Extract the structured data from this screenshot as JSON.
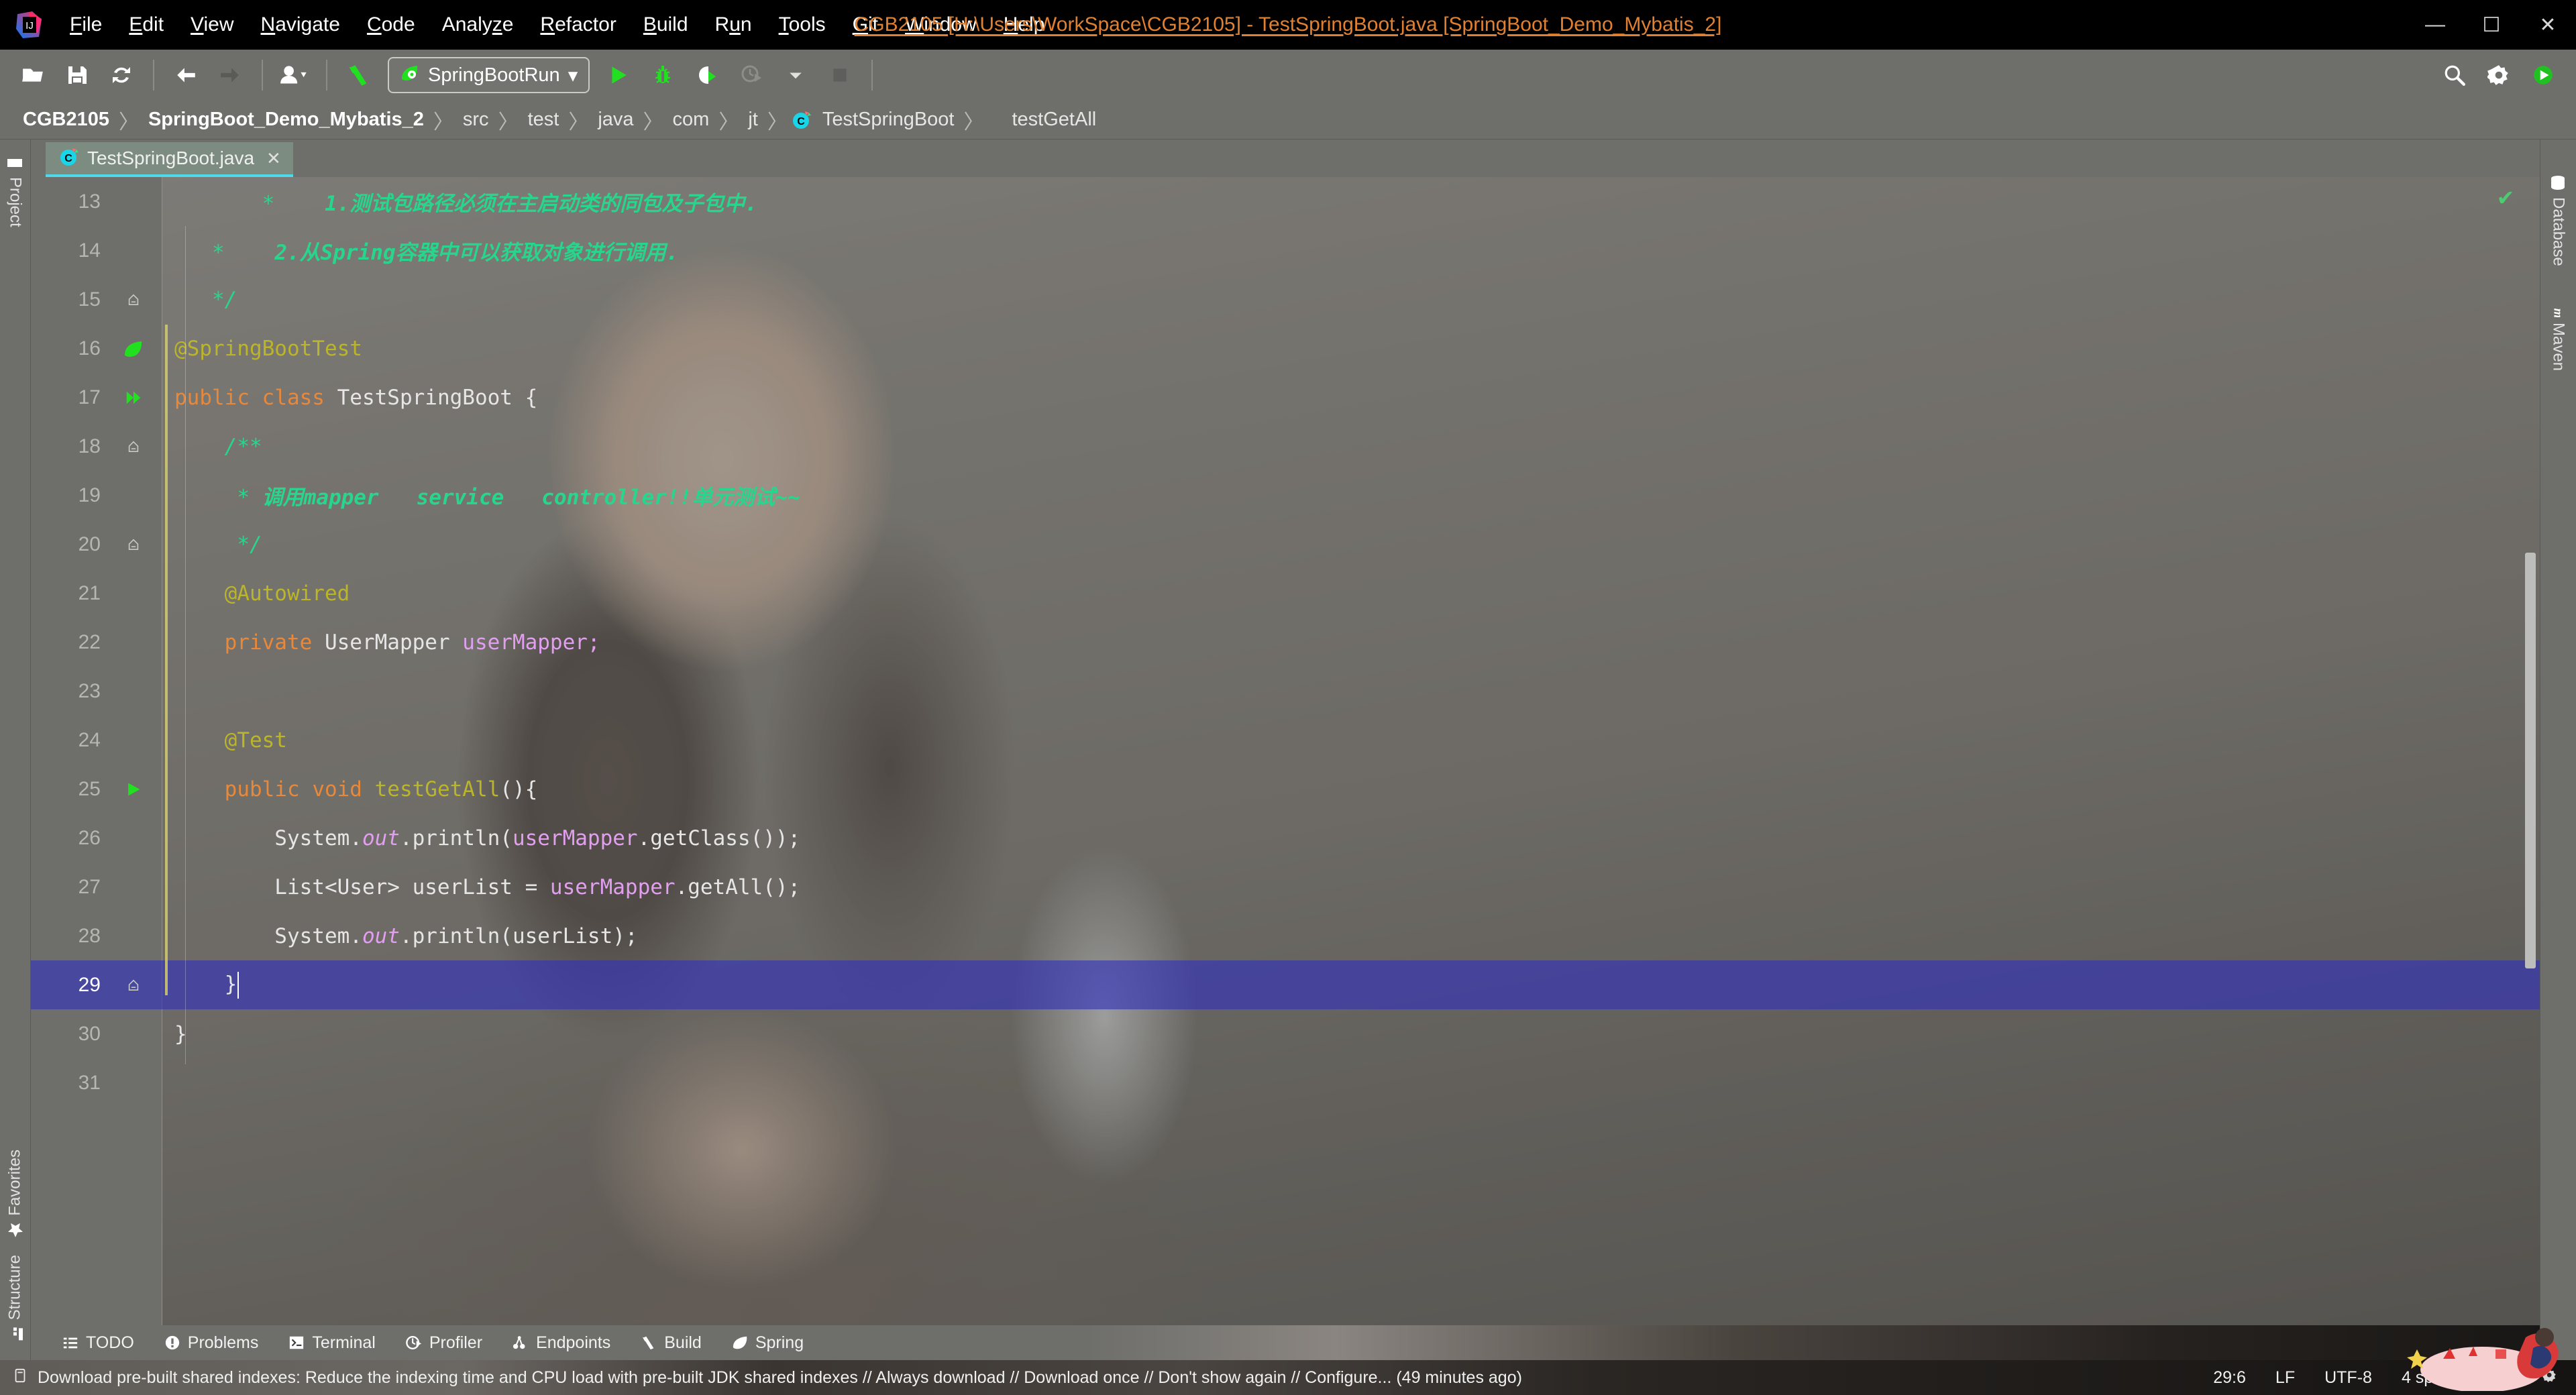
{
  "window": {
    "title": "CGB2105 [H:\\Users\\WorkSpace\\CGB2105] - TestSpringBoot.java [SpringBoot_Demo_Mybatis_2]",
    "minimize": "—",
    "maximize": "☐",
    "close": "✕",
    "accent_orange": "#e08030",
    "titlebar_bg": "#000000",
    "chrome_bg": "#6e6e6b"
  },
  "menu": {
    "items": [
      {
        "label": "File",
        "mnemonic": "F"
      },
      {
        "label": "Edit",
        "mnemonic": "E"
      },
      {
        "label": "View",
        "mnemonic": "V"
      },
      {
        "label": "Navigate",
        "mnemonic": "N"
      },
      {
        "label": "Code",
        "mnemonic": "C"
      },
      {
        "label": "Analyze",
        "mnemonic": "z"
      },
      {
        "label": "Refactor",
        "mnemonic": "R"
      },
      {
        "label": "Build",
        "mnemonic": "B"
      },
      {
        "label": "Run",
        "mnemonic": "u"
      },
      {
        "label": "Tools",
        "mnemonic": "T"
      },
      {
        "label": "Git",
        "mnemonic": "G"
      },
      {
        "label": "Window",
        "mnemonic": "W"
      },
      {
        "label": "Help",
        "mnemonic": "H"
      }
    ]
  },
  "toolbar": {
    "icons": [
      "open-folder-icon",
      "save-all-icon",
      "sync-refresh-icon",
      "back-arrow-icon",
      "forward-arrow-icon",
      "profile-dropdown-icon",
      "build-hammer-icon"
    ],
    "run_config": {
      "label": "SpringBootRun",
      "icon": "spring-leaf-icon",
      "chevron": "▾"
    },
    "run_actions": [
      "run-icon",
      "debug-icon",
      "run-with-coverage-icon",
      "profile-icon",
      "more-chevron-icon",
      "stop-icon"
    ],
    "right_icons": [
      "search-icon",
      "settings-gear-icon",
      "update-project-icon"
    ]
  },
  "breadcrumb": {
    "items": [
      {
        "label": "CGB2105",
        "bold": true,
        "icon": null
      },
      {
        "label": "SpringBoot_Demo_Mybatis_2",
        "bold": true,
        "icon": null
      },
      {
        "label": "src",
        "bold": false,
        "icon": null
      },
      {
        "label": "test",
        "bold": false,
        "icon": null
      },
      {
        "label": "java",
        "bold": false,
        "icon": null
      },
      {
        "label": "com",
        "bold": false,
        "icon": null
      },
      {
        "label": "jt",
        "bold": false,
        "icon": null
      },
      {
        "label": "TestSpringBoot",
        "bold": false,
        "icon": "java-class-icon"
      },
      {
        "label": "testGetAll",
        "bold": false,
        "icon": null
      }
    ],
    "separator": "〉"
  },
  "editor_tabs": [
    {
      "label": "TestSpringBoot.java",
      "icon": "java-class-icon",
      "close": "✕",
      "active": true
    }
  ],
  "left_toolwindows": [
    {
      "label": "Project",
      "icon": "project-folder-icon"
    },
    {
      "label": "Structure",
      "icon": "structure-icon"
    },
    {
      "label": "Favorites",
      "icon": "star-icon"
    }
  ],
  "right_toolwindows": [
    {
      "label": "Database",
      "icon": "database-icon"
    },
    {
      "label": "Maven",
      "icon": "maven-m-icon"
    }
  ],
  "code": {
    "first_visible_line": 13,
    "current_line": 29,
    "lines": [
      {
        "n": 13,
        "gutter": "",
        "tokens": [
          {
            "t": "       *    ",
            "c": "cmt"
          },
          {
            "t": "1.测试包路径必须在主启动类的同包及子包中.",
            "c": "cmt-b"
          }
        ]
      },
      {
        "n": 14,
        "gutter": "",
        "tokens": [
          {
            "t": "   *    ",
            "c": "cmt"
          },
          {
            "t": "2.从Spring容器中可以获取对象进行调用.",
            "c": "cmt-b"
          }
        ]
      },
      {
        "n": 15,
        "gutter": "fold-end",
        "tokens": [
          {
            "t": "   */",
            "c": "cmt"
          }
        ]
      },
      {
        "n": 16,
        "gutter": "spring-bean",
        "tokens": [
          {
            "t": "@SpringBootTest",
            "c": "ann"
          }
        ]
      },
      {
        "n": 17,
        "gutter": "run-class",
        "tokens": [
          {
            "t": "public ",
            "c": "kw"
          },
          {
            "t": "class ",
            "c": "kw"
          },
          {
            "t": "TestSpringBoot ",
            "c": "plain"
          },
          {
            "t": "{",
            "c": "plain"
          }
        ]
      },
      {
        "n": 18,
        "gutter": "fold-start",
        "tokens": [
          {
            "t": "    /**",
            "c": "cmt"
          }
        ]
      },
      {
        "n": 19,
        "gutter": "",
        "tokens": [
          {
            "t": "     * ",
            "c": "cmt"
          },
          {
            "t": "调用mapper   service   controller!!单元测试~~",
            "c": "cmt-b"
          }
        ]
      },
      {
        "n": 20,
        "gutter": "fold-end",
        "tokens": [
          {
            "t": "     */",
            "c": "cmt"
          }
        ]
      },
      {
        "n": 21,
        "gutter": "",
        "tokens": [
          {
            "t": "    @Autowired",
            "c": "ann"
          }
        ]
      },
      {
        "n": 22,
        "gutter": "",
        "tokens": [
          {
            "t": "    private ",
            "c": "kw"
          },
          {
            "t": "UserMapper ",
            "c": "plain"
          },
          {
            "t": "userMapper;",
            "c": "fld"
          }
        ]
      },
      {
        "n": 23,
        "gutter": "",
        "tokens": [
          {
            "t": "",
            "c": "plain"
          }
        ]
      },
      {
        "n": 24,
        "gutter": "",
        "tokens": [
          {
            "t": "    @Test",
            "c": "ann"
          }
        ]
      },
      {
        "n": 25,
        "gutter": "run-method",
        "tokens": [
          {
            "t": "    public ",
            "c": "kw"
          },
          {
            "t": "void ",
            "c": "kw"
          },
          {
            "t": "testGetAll",
            "c": "ann"
          },
          {
            "t": "(){",
            "c": "plain"
          }
        ]
      },
      {
        "n": 26,
        "gutter": "",
        "tokens": [
          {
            "t": "        System.",
            "c": "plain"
          },
          {
            "t": "out",
            "c": "stat"
          },
          {
            "t": ".println(",
            "c": "plain"
          },
          {
            "t": "userMapper",
            "c": "fld"
          },
          {
            "t": ".getClass());",
            "c": "plain"
          }
        ]
      },
      {
        "n": 27,
        "gutter": "",
        "tokens": [
          {
            "t": "        List<User> userList = ",
            "c": "plain"
          },
          {
            "t": "userMapper",
            "c": "fld"
          },
          {
            "t": ".getAll();",
            "c": "plain"
          }
        ]
      },
      {
        "n": 28,
        "gutter": "",
        "tokens": [
          {
            "t": "        System.",
            "c": "plain"
          },
          {
            "t": "out",
            "c": "stat"
          },
          {
            "t": ".println(userList);",
            "c": "plain"
          }
        ]
      },
      {
        "n": 29,
        "gutter": "fold-end",
        "tokens": [
          {
            "t": "    }",
            "c": "plain"
          }
        ],
        "current": true,
        "caret_after": true
      },
      {
        "n": 30,
        "gutter": "",
        "tokens": [
          {
            "t": "}",
            "c": "plain"
          }
        ]
      },
      {
        "n": 31,
        "gutter": "",
        "tokens": [
          {
            "t": "",
            "c": "plain"
          }
        ]
      }
    ],
    "inspection_status": "✔"
  },
  "bottom_toolwindows": [
    {
      "label": "TODO",
      "icon": "todo-list-icon"
    },
    {
      "label": "Problems",
      "icon": "problems-warning-icon"
    },
    {
      "label": "Terminal",
      "icon": "terminal-icon"
    },
    {
      "label": "Profiler",
      "icon": "profiler-icon"
    },
    {
      "label": "Endpoints",
      "icon": "endpoints-icon"
    },
    {
      "label": "Build",
      "icon": "build-hammer-icon"
    },
    {
      "label": "Spring",
      "icon": "spring-leaf-icon"
    }
  ],
  "statusbar": {
    "icon": "notification-icon",
    "message": "Download pre-built shared indexes: Reduce the indexing time and CPU load with pre-built JDK shared indexes // Always download // Download once // Don't show again // Configure... (49 minutes ago)",
    "caret_position": "29:6",
    "line_separator": "LF",
    "encoding": "UTF-8",
    "indent": "4 spaces",
    "lock_icon": "lock-icon",
    "gear_icon": "settings-gear-icon"
  }
}
